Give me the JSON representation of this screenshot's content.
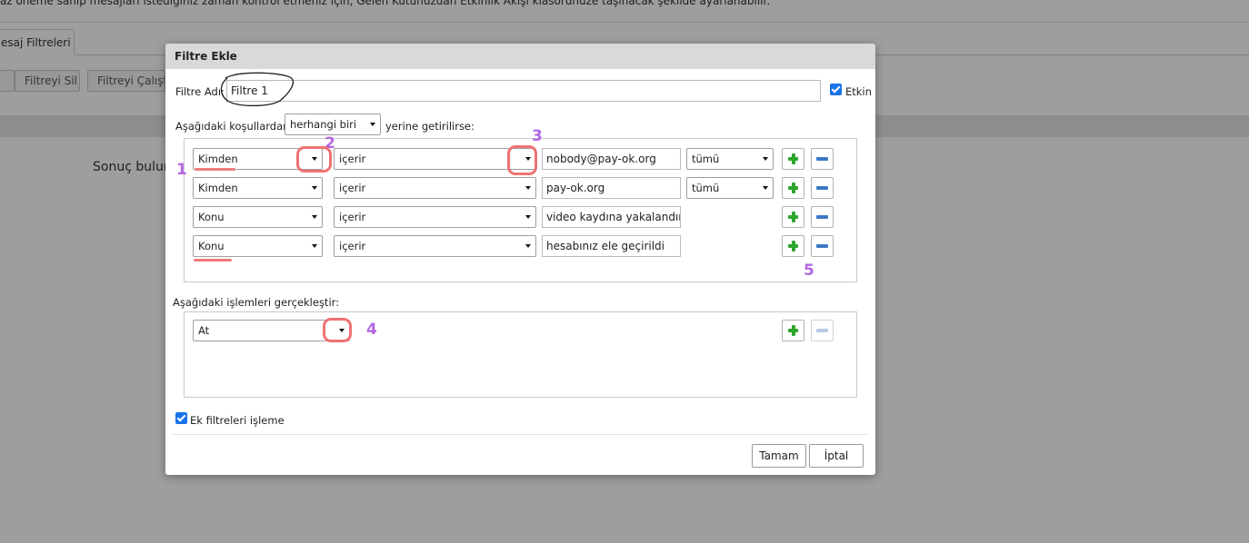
{
  "background": {
    "top_text": "az öneme sahip mesajları istediğiniz zaman kontrol etmeniz için, Gelen Kutunuzdan Etkinlik Akışı klasörünüze taşınacak şekilde ayarlanabilir.",
    "tab_label": "esaj Filtreleri",
    "delete_filter_button": "Filtreyi Sil",
    "run_filter_button": "Filtreyi Çalıştır",
    "result_text": "Sonuç bulun"
  },
  "dialog": {
    "title": "Filtre Ekle",
    "filter_name_label": "Filtre Adı:",
    "filter_name_value": "Filtre 1",
    "enabled_label": "Etkin",
    "conditions_prefix": "Aşağıdaki koşullardan",
    "match_select": "herhangi biri",
    "conditions_suffix": "yerine getirilirse:",
    "conditions": [
      {
        "field": "Kimden",
        "operator": "içerir",
        "value": "nobody@pay-ok.org",
        "scope": "tümü"
      },
      {
        "field": "Kimden",
        "operator": "içerir",
        "value": "pay-ok.org",
        "scope": "tümü"
      },
      {
        "field": "Konu",
        "operator": "içerir",
        "value": "video kaydına yakalandınız",
        "scope": ""
      },
      {
        "field": "Konu",
        "operator": "içerir",
        "value": "hesabınız ele geçirildi",
        "scope": ""
      }
    ],
    "actions_label": "Aşağıdaki işlemleri gerçekleştir:",
    "action_select": "At",
    "no_more_filters_label": "Ek filtreleri işleme",
    "ok_button": "Tamam",
    "cancel_button": "İptal"
  },
  "annotations": [
    "1",
    "2",
    "3",
    "4",
    "5"
  ],
  "colors": {
    "annotation_number": "#b367e3",
    "annotation_mark": "#ef7b7b",
    "checkbox": "#1a73e8",
    "plus_icon": "#2ea52e",
    "minus_icon": "#3c78c8"
  }
}
